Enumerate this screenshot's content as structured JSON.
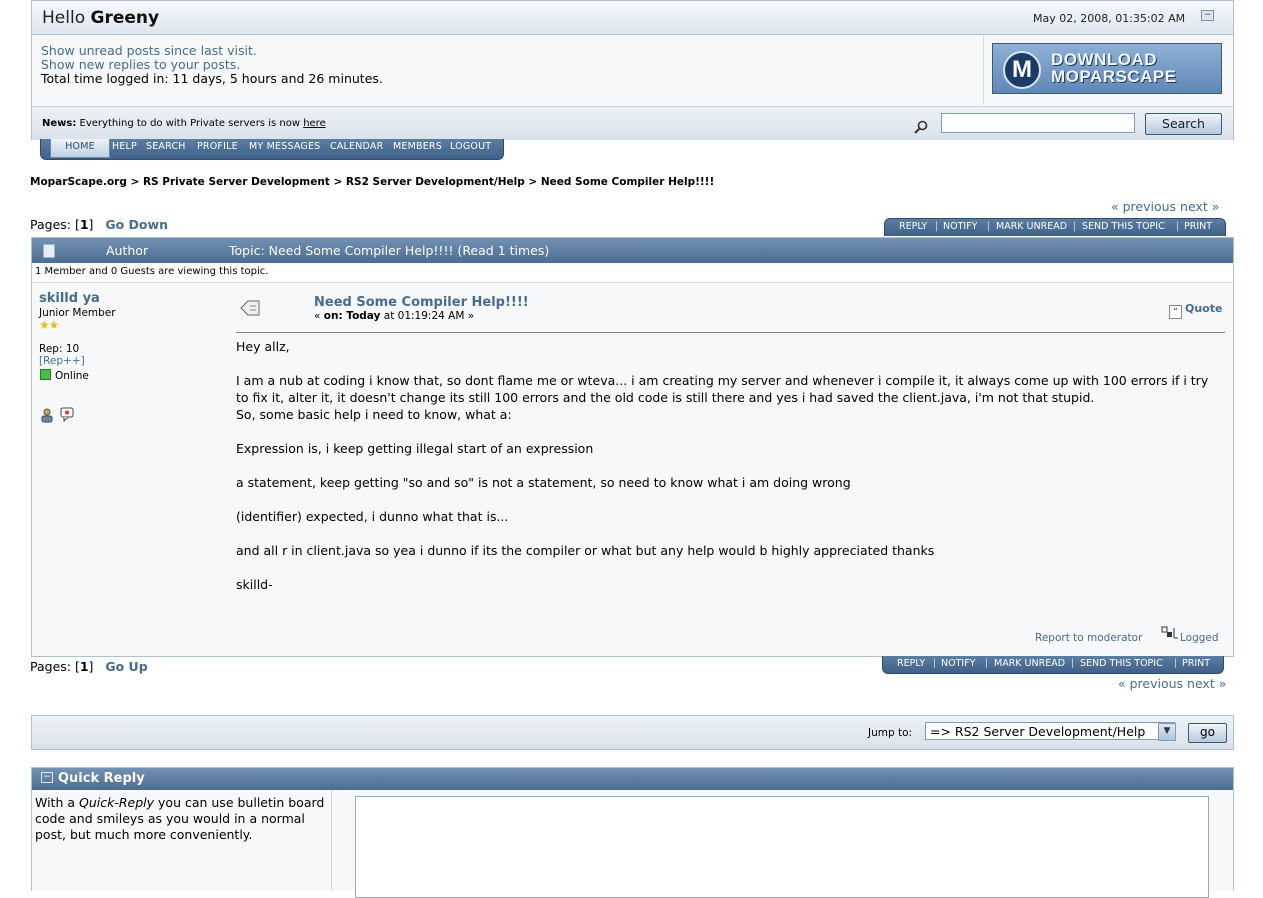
{
  "header": {
    "greeting": "Hello",
    "username": "Greeny",
    "datetime": "May 02, 2008, 01:35:02 AM",
    "unread_link": "Show unread posts since last visit.",
    "replies_link": "Show new replies to your posts.",
    "time_logged": "Total time logged in: 11 days, 5 hours and 26 minutes.",
    "banner_line1": "DOWNLOAD",
    "banner_line2": "MOPARSCAPE",
    "banner_logo": "M"
  },
  "news": {
    "label": "News:",
    "text": "Everything to do with Private servers is now",
    "link": "here"
  },
  "search": {
    "value": "",
    "button": "Search"
  },
  "maintabs": [
    "HOME",
    "HELP",
    "SEARCH",
    "PROFILE",
    "MY MESSAGES",
    "CALENDAR",
    "MEMBERS",
    "LOGOUT"
  ],
  "breadcrumb": "MoparScape.org > RS Private Server Development > RS2 Server Development/Help > Need Some Compiler Help!!!!",
  "nav": {
    "prevnext": "« previous next »",
    "pages_label": "Pages: [",
    "page": "1",
    "pages_close": "]",
    "go_down": "Go Down",
    "go_up": "Go Up"
  },
  "topic_buttons": [
    "REPLY",
    "NOTIFY",
    "MARK UNREAD",
    "SEND THIS TOPIC",
    "PRINT"
  ],
  "topic": {
    "author_header": "Author",
    "title_header": "Topic: Need Some Compiler Help!!!!  (Read 1 times)",
    "viewing": "1 Member and 0 Guests are viewing this topic."
  },
  "post": {
    "poster": "skilld ya",
    "rank": "Junior Member",
    "stars": "★★",
    "rep": "Rep: 10",
    "rep_link": "[Rep++]",
    "status": "Online",
    "subject": "Need Some Compiler Help!!!!",
    "date_prefix": "« ",
    "date_bold": "on: Today",
    "date_rest": " at 01:19:24 AM »",
    "quote": "Quote",
    "body": [
      "Hey allz,",
      "",
      "I am a nub at coding i know that, so dont flame me or wteva... i am creating my server and whenever i compile it, it always come up with 100 errors if i try to fix it, alter it, it doesn't change its still 100 errors and the old code is still there and yes i had saved the client.java, i'm not that stupid.",
      "So, some basic help i need to know, what a:",
      "",
      "Expression is, i keep getting illegal start of an expression",
      "",
      "a statement, keep getting \"so and so\" is not a statement, so need to know what i am doing wrong",
      "",
      "(identifier) expected, i dunno what that is...",
      "",
      "and all r in client.java so yea i dunno if its the compiler or what but any help would b highly appreciated thanks",
      "",
      "skilld-"
    ],
    "report": "Report to moderator",
    "logged": "Logged"
  },
  "jump": {
    "label": "Jump to:",
    "selected": "=> RS2 Server Development/Help",
    "go": "go"
  },
  "quick_reply": {
    "title": "Quick Reply",
    "desc_1": "With a ",
    "desc_em": "Quick-Reply",
    "desc_2": " you can use bulletin board code and smileys as you would in a normal post, but much more conveniently."
  }
}
